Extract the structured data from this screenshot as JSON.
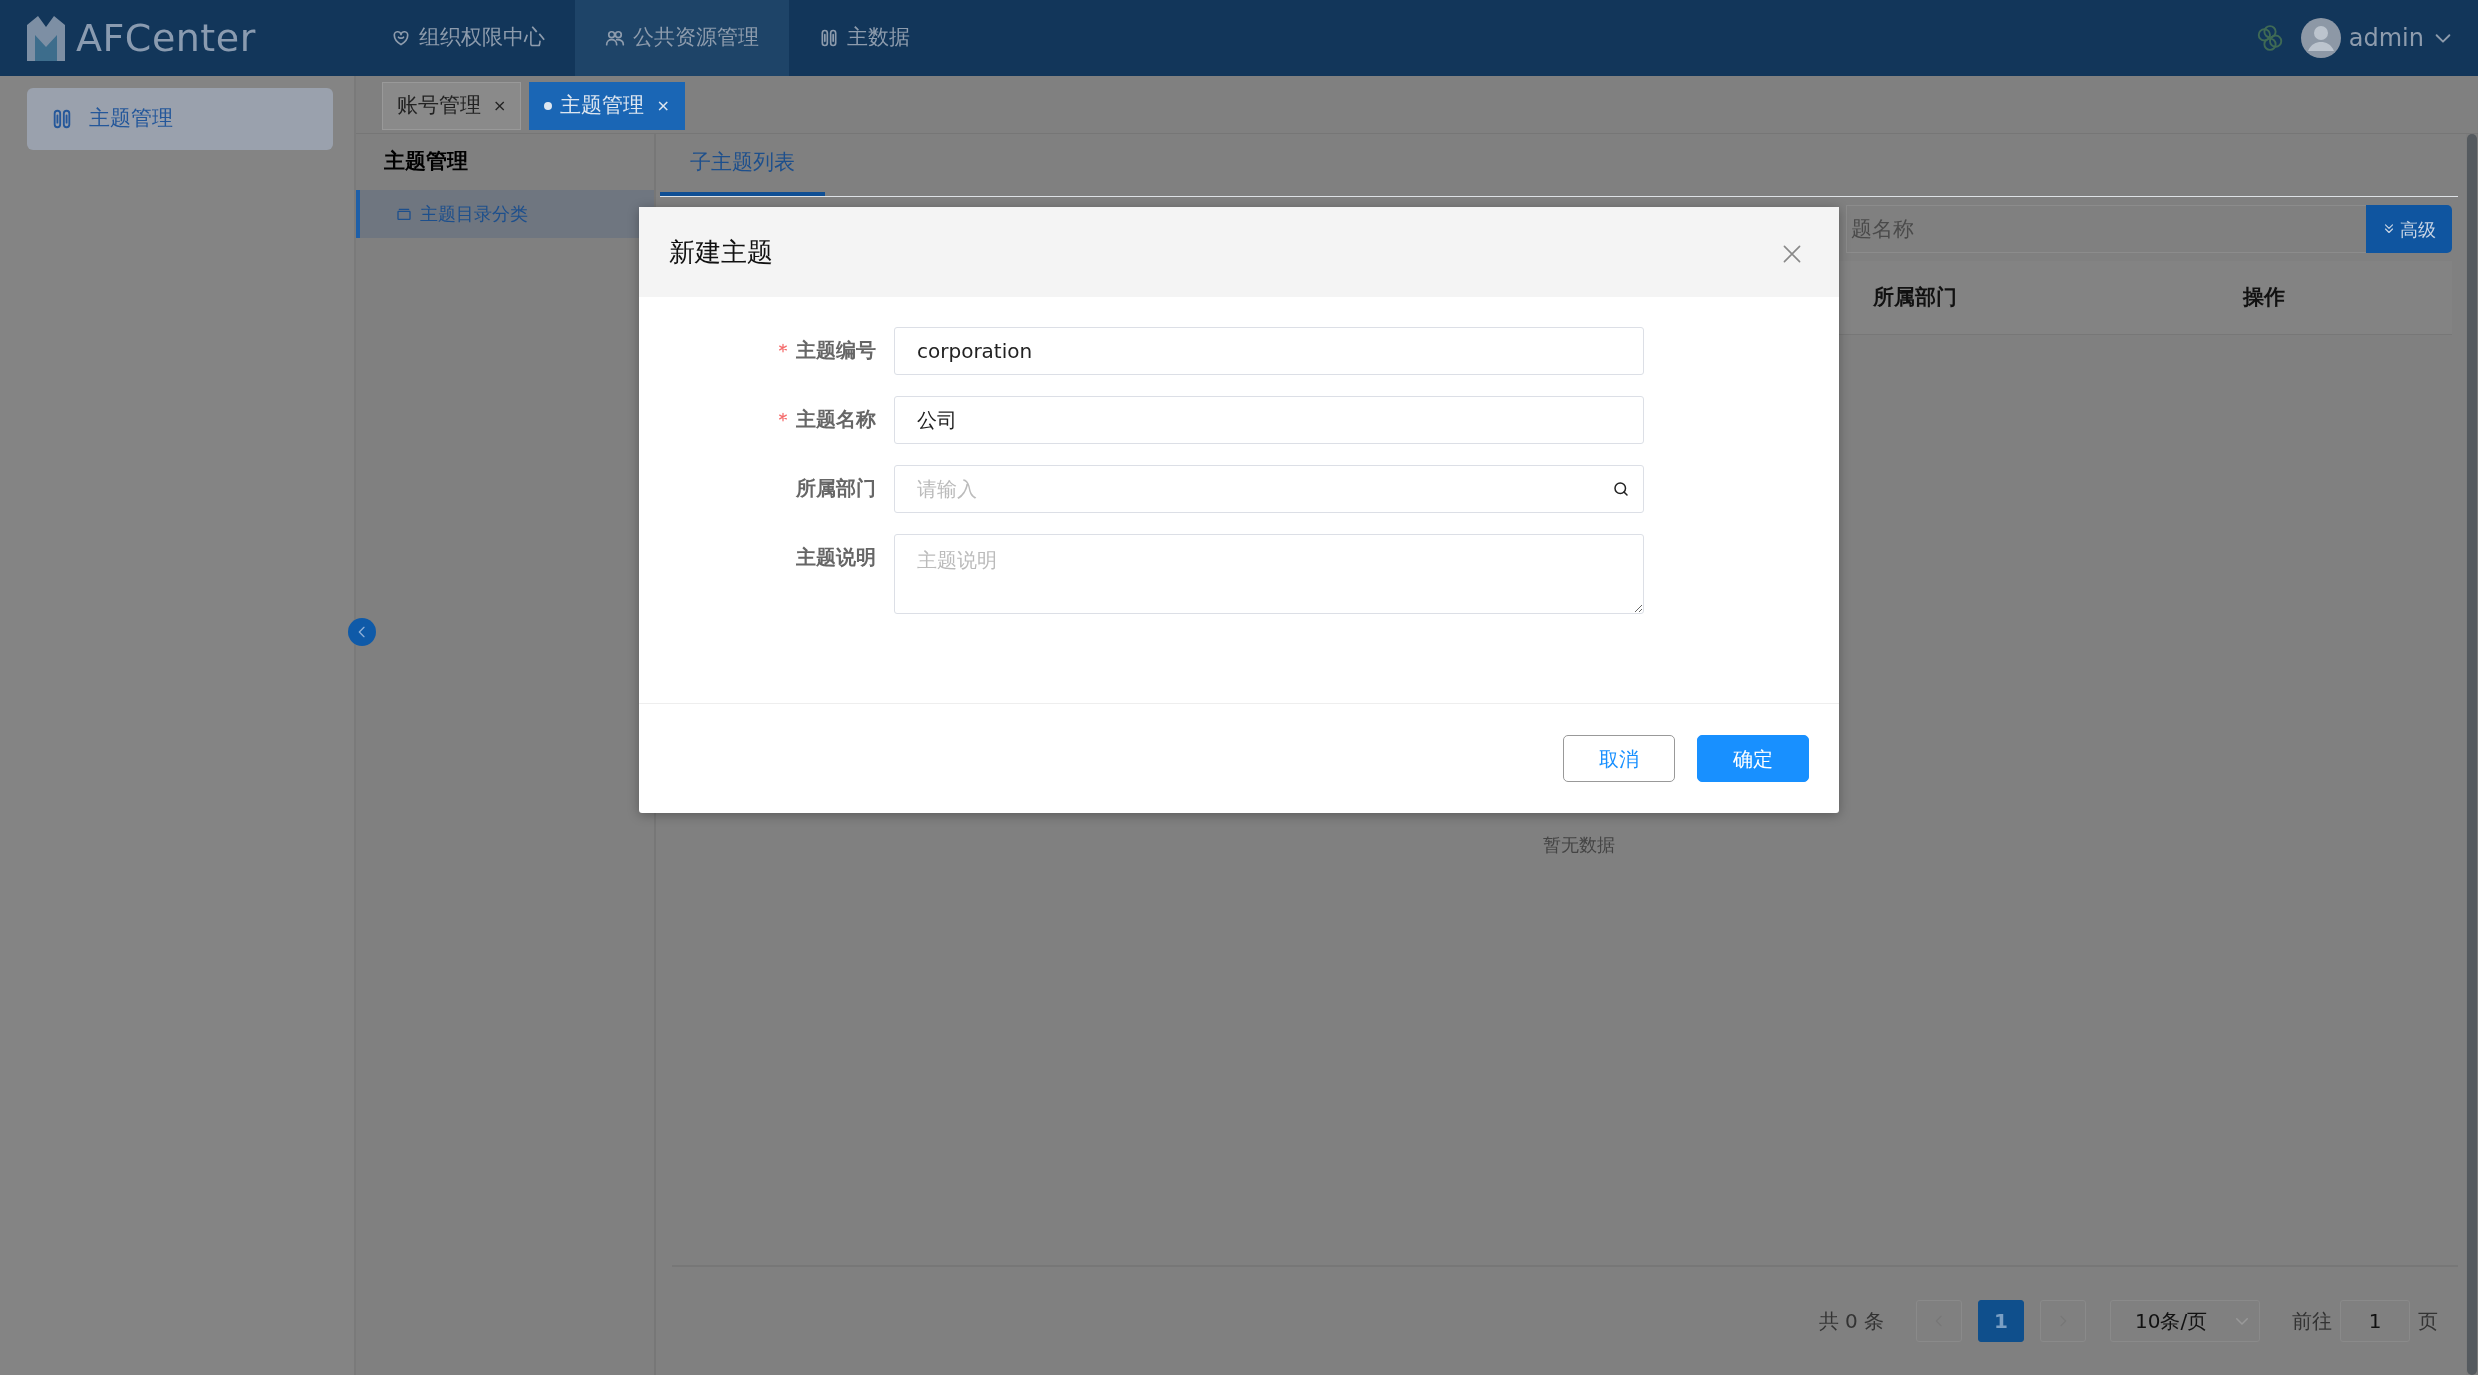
{
  "header": {
    "logo": "AFCenter",
    "nav": [
      {
        "label": "组织权限中心",
        "selected": false
      },
      {
        "label": "公共资源管理",
        "selected": true
      },
      {
        "label": "主数据",
        "selected": false
      }
    ],
    "user": "admin"
  },
  "sidebar": {
    "items": [
      {
        "label": "主题管理",
        "selected": true
      }
    ]
  },
  "page_tabs": [
    {
      "label": "账号管理",
      "selected": false,
      "close": "×"
    },
    {
      "label": "主题管理",
      "selected": true,
      "close": "×"
    }
  ],
  "tree_panel": {
    "title": "主题管理",
    "items": [
      {
        "label": "主题目录分类",
        "selected": true
      }
    ]
  },
  "content": {
    "tabs": [
      {
        "label": "子主题列表",
        "selected": true
      }
    ],
    "search": {
      "placeholder": "题名称"
    },
    "advanced_button": "高级",
    "table": {
      "columns": [
        "所属部门",
        "操作"
      ],
      "empty_text": "暂无数据"
    },
    "pagination": {
      "total": "共 0 条",
      "pages": [
        {
          "label": "1",
          "selected": true
        }
      ],
      "page_size": "10条/页",
      "goto_label": "前往",
      "goto_value": "1",
      "page_unit": "页"
    }
  },
  "dialog": {
    "title": "新建主题",
    "fields": [
      {
        "label": "主题编号",
        "required": true,
        "kind": "input",
        "value": "corporation"
      },
      {
        "label": "主题名称",
        "required": true,
        "kind": "input",
        "value": "公司"
      },
      {
        "label": "所属部门",
        "required": false,
        "kind": "search",
        "placeholder": "请输入"
      },
      {
        "label": "主题说明",
        "required": false,
        "kind": "textarea",
        "placeholder": "主题说明"
      }
    ],
    "buttons": [
      {
        "label": "取消",
        "kind": "secondary"
      },
      {
        "label": "确定",
        "kind": "primary"
      }
    ]
  }
}
